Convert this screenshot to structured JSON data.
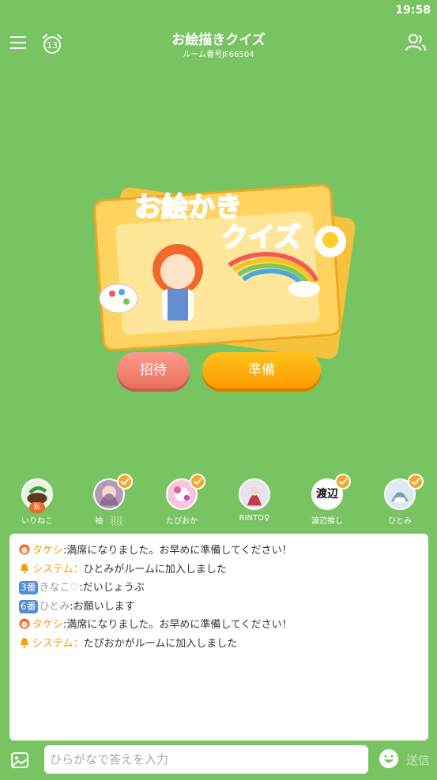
{
  "status_bar": {
    "time": "19:58"
  },
  "header": {
    "title": "お絵描きクイズ",
    "room_number": "ルーム番号JF66504",
    "timer_value": "13"
  },
  "hero": {
    "line1": "お絵かき",
    "line2": "クイズ"
  },
  "buttons": {
    "invite": "招待",
    "ready": "準備"
  },
  "players": [
    {
      "name": "いりねこ",
      "me_tag": "私",
      "ready": false,
      "avatar_text": ""
    },
    {
      "name": "袖　░░",
      "ready": true,
      "avatar_text": ""
    },
    {
      "name": "たぴおか",
      "ready": true,
      "avatar_text": ""
    },
    {
      "name": "RINTO♀",
      "ready": false,
      "avatar_text": ""
    },
    {
      "name": "渡辺推し",
      "ready": true,
      "avatar_text": "渡辺"
    },
    {
      "name": "ひとみ",
      "ready": true,
      "avatar_text": ""
    }
  ],
  "chat": {
    "messages": [
      {
        "type": "user",
        "sender": "タケシ",
        "sep": ":",
        "text": "満席になりました。お早めに準備してください！"
      },
      {
        "type": "system",
        "sender": "システム",
        "sep": "：",
        "text": "ひとみがルームに加入しました"
      },
      {
        "type": "numbered",
        "number": "3番",
        "sender": "きなこ♡",
        "sep": ":",
        "text": "だいじょうぶ"
      },
      {
        "type": "numbered",
        "number": "6番",
        "sender": "ひとみ",
        "sep": ":",
        "text": "お願いします"
      },
      {
        "type": "user",
        "sender": "タケシ",
        "sep": ":",
        "text": "満席になりました。お早めに準備してください！"
      },
      {
        "type": "system",
        "sender": "システム",
        "sep": "：",
        "text": "たぴおかがルームに加入しました"
      }
    ]
  },
  "input": {
    "placeholder": "ひらがなで答えを入力",
    "value": "",
    "send_label": "送信"
  },
  "colors": {
    "background": "#79c462",
    "invite": "#e7705f",
    "ready": "#ff9a00",
    "system_sender": "#f2a300",
    "number_badge": "#4f8fd4"
  },
  "icons": {
    "menu": "hamburger-menu-icon",
    "timer": "alarm-clock-icon",
    "members": "users-icon",
    "image": "image-icon",
    "emoji": "smile-icon",
    "system": "bell-icon"
  }
}
